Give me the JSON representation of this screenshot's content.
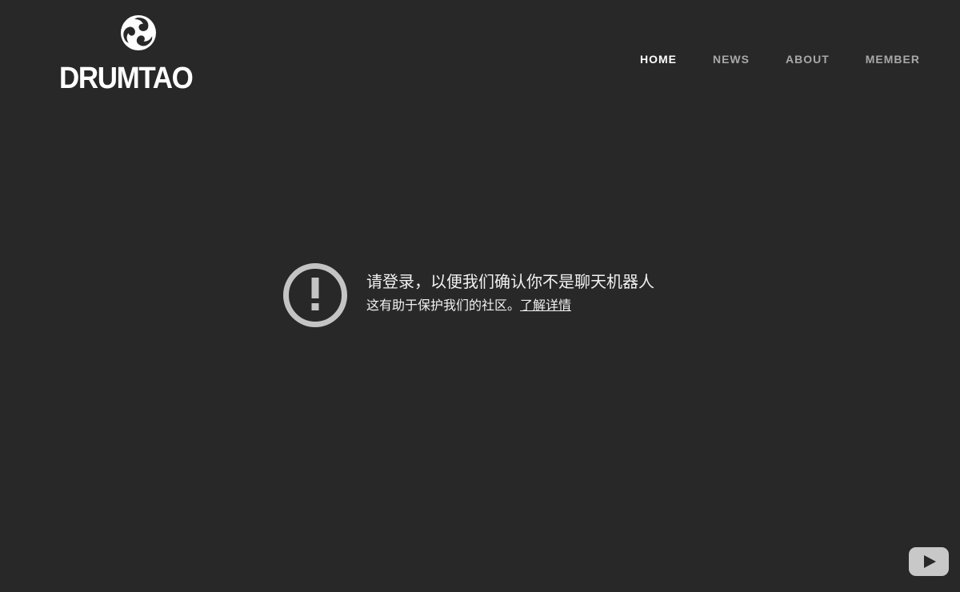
{
  "logo": {
    "text": "DRUMTAO"
  },
  "nav": {
    "items": [
      {
        "label": "HOME",
        "active": true
      },
      {
        "label": "NEWS",
        "active": false
      },
      {
        "label": "ABOUT",
        "active": false
      },
      {
        "label": "MEMBER",
        "active": false
      }
    ]
  },
  "message": {
    "title": "请登录，以便我们确认你不是聊天机器人",
    "subtitle": "这有助于保护我们的社区。",
    "link_label": "了解详情"
  },
  "icons": {
    "logo_mark": "tomoe-icon",
    "alert": "alert-circle-icon",
    "video_button": "youtube-play-icon"
  },
  "colors": {
    "background": "#282828",
    "text": "#f1f1f1",
    "nav_inactive": "#a8a8a8",
    "nav_active": "#ffffff",
    "icon_gray": "#c4c4c4"
  }
}
